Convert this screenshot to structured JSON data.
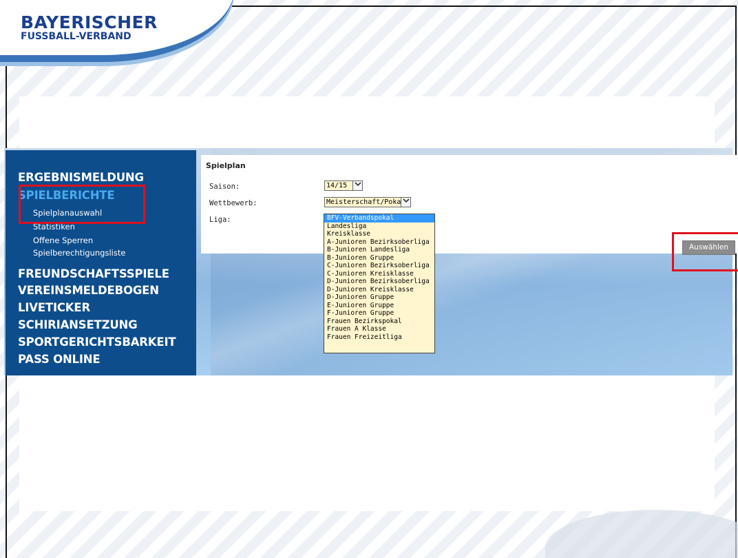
{
  "header": {
    "logo_line1": "BAYERISCHER",
    "logo_line2": "FUSSBALL-VERBAND"
  },
  "sidebar": {
    "main_items": [
      {
        "label": "ERGEBNISMELDUNG"
      },
      {
        "label": "SPIELBERICHTE",
        "active": true
      },
      {
        "label": "FREUNDSCHAFTSSPIELE"
      },
      {
        "label": "VEREINSMELDEBOGEN"
      },
      {
        "label": "LIVETICKER"
      },
      {
        "label": "SCHIRIANSETZUNG"
      },
      {
        "label": "SPORTGERICHTSBARKEIT"
      },
      {
        "label": "PASS ONLINE"
      }
    ],
    "sub_items": [
      {
        "label": "Spielplanauswahl"
      },
      {
        "label": "Statistiken"
      },
      {
        "label": "Offene Sperren"
      },
      {
        "label": "Spielberechtigungsliste"
      }
    ]
  },
  "form": {
    "title": "Spielplan",
    "saison_label": "Saison:",
    "saison_value": "14/15",
    "wettbewerb_label": "Wettbewerb:",
    "wettbewerb_value": "Meisterschaft/Pokal",
    "liga_label": "Liga:",
    "liga_options": [
      "BFV-Verbandspokal",
      "Landesliga",
      "Kreisklasse",
      "A-Junioren Bezirksoberliga",
      "B-Junioren Landesliga",
      "B-Junioren Gruppe",
      "C-Junioren Bezirksoberliga",
      "C-Junioren Kreisklasse",
      "D-Junioren Bezirksoberliga",
      "D-Junioren Kreisklasse",
      "D-Junioren Gruppe",
      "E-Junioren Gruppe",
      "F-Junioren Gruppe",
      "Frauen Bezirkspokal",
      "Frauen A Klasse",
      "Frauen Freizeitliga"
    ],
    "liga_selected_index": 0,
    "submit_label": "Auswählen"
  },
  "icons": {
    "dropdown_arrow": "chevron-down-icon"
  },
  "colors": {
    "sidebar_bg": "#0d4d8c",
    "active_nav": "#48aaf0",
    "highlight_box": "#e0101d",
    "selected_option": "#3399ff",
    "field_bg": "#fff6d0"
  }
}
